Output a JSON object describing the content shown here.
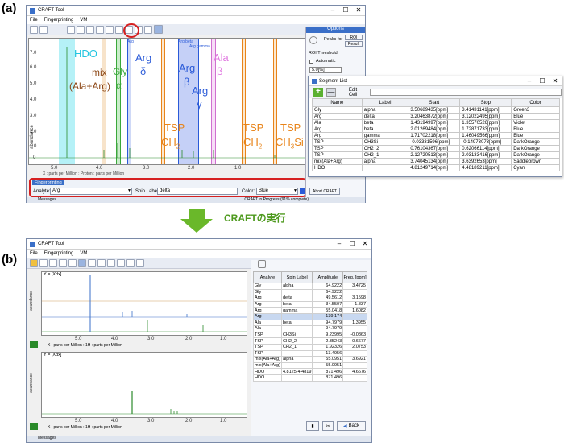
{
  "panel_a": {
    "label": "(a)",
    "window_title": "CRAFT Tool",
    "menu": [
      "File",
      "Fingerprinting",
      "VM"
    ],
    "y_axis_label": "abundance",
    "y_ticks": [
      "7.0",
      "6.0",
      "5.0",
      "4.0",
      "3.0",
      "2.0",
      "1.0",
      "0"
    ],
    "x_ticks": [
      "5.0",
      "4.0",
      "3.0",
      "2.0",
      "1.0"
    ],
    "x_axis_text": "X : parts per Million : Proton : parts per Million",
    "annotations": {
      "hdo": "HDO",
      "mix1": "mix",
      "mix2": "(Ala+Arg)",
      "gly1": "Gly",
      "gly2": "α",
      "arg_delta1": "Arg",
      "arg_delta2": "δ",
      "arg_beta1": "Arg",
      "arg_beta2": "β",
      "arg_gamma1": "Arg",
      "arg_gamma2": "γ",
      "ala1": "Ala",
      "ala2": "β",
      "tsp1_1": "TSP",
      "tsp1_2": "CH",
      "tsp1_sub": "2",
      "tsp2_1": "TSP",
      "tsp2_2": "CH",
      "tsp2_sub": "2",
      "tsp3_1": "TSP",
      "tsp3_2": "CH",
      "tsp3_sub": "3",
      "tsp3_end": "Si",
      "band_tag_arg_beta": "Arg beta",
      "band_tag_arg_gamma": "Arg gamma",
      "band_tag_arg": "Arg"
    },
    "options": {
      "title": "Options",
      "peaks_for": "Peaks for",
      "roi_button": "ROI",
      "result_button": "Result",
      "roi_threshold": "ROI Threshold",
      "automatic": "Automatic",
      "threshold_value": "5.0[%]",
      "abort_button": "Abort CRAFT"
    },
    "fingerprinting": {
      "tab": "Fingerprinting",
      "analyte_label": "Analyte:",
      "analyte_value": "Arg",
      "spin_label": "Spin Label:",
      "spin_value": "delta",
      "color_label": "Color:",
      "color_value": "Blue"
    },
    "status_left": "Messages",
    "status_right": "CRAFT in Progress (91% complete)",
    "segment_list": {
      "title": "Segment List",
      "edit_cell": "Edit Cell",
      "columns": [
        "Name",
        "Label",
        "Start",
        "Stop",
        "Color"
      ],
      "rows": [
        [
          "Gly",
          "alpha",
          "3.50689435[ppm]",
          "3.41431141[ppm]",
          "Green3"
        ],
        [
          "Arg",
          "delta",
          "3.20463872[ppm]",
          "3.12022495[ppm]",
          "Blue"
        ],
        [
          "Ala",
          "beta",
          "1.43194997[ppm]",
          "1.35570526[ppm]",
          "Violet"
        ],
        [
          "Arg",
          "beta",
          "2.01269484[ppm]",
          "1.72871733[ppm]",
          "Blue"
        ],
        [
          "Arg",
          "gamma",
          "1.71702218[ppm]",
          "1.46049566[ppm]",
          "Blue"
        ],
        [
          "TSP",
          "CH3Si",
          "-0.03331596[ppm]",
          "-0.14973073[ppm]",
          "DarkOrange"
        ],
        [
          "TSP",
          "CH2_2",
          "0.76104367[ppm]",
          "0.62066114[ppm]",
          "DarkOrange"
        ],
        [
          "TSP",
          "CH2_1",
          "2.12720513[ppm]",
          "2.03133416[ppm]",
          "DarkOrange"
        ],
        [
          "mix(Ala+Arg)",
          "alpha",
          "3.74045134[ppm]",
          "3.6392653[ppm]",
          "Saddlebrown"
        ],
        [
          "HDO",
          "",
          "4.81249714[ppm]",
          "4.48189211[ppm]",
          "Cyan"
        ]
      ]
    }
  },
  "arrow_caption": "CRAFTの実行",
  "panel_b": {
    "label": "(b)",
    "window_title": "CRAFT Tool",
    "menu": [
      "File",
      "Fingerprinting",
      "VM"
    ],
    "plot1_label": "Y = [Xdx]",
    "plot2_label": "Y = [Xdx]",
    "y_axis_label": "abundance",
    "x_ticks": [
      "5.0",
      "4.0",
      "3.0",
      "2.0",
      "1.0"
    ],
    "x_axis_text1": "X : parts per Million : 1H : parts per Million",
    "x_axis_text2": "X : parts per Million : 1H : parts per Million",
    "status_left": "Messages",
    "back_button": "Back",
    "result_columns": [
      "Analyte",
      "Spin Label",
      "Amplitude",
      "Freq.\n[ppm]"
    ],
    "result_rows": [
      [
        "Gly",
        "alpha",
        "64.9222",
        "3.4725"
      ],
      [
        "Gly",
        "",
        "64.9222",
        ""
      ],
      [
        "Arg",
        "delta",
        "49.5612",
        "3.1598"
      ],
      [
        "Arg",
        "beta",
        "34.5507",
        "1.837"
      ],
      [
        "Arg",
        "gamma",
        "55.0418",
        "1.6082"
      ],
      [
        "Arg",
        "",
        "139.174",
        ""
      ],
      [
        "Ala",
        "beta",
        "94.7979",
        "1.3955"
      ],
      [
        "Ala",
        "",
        "94.7979",
        ""
      ],
      [
        "TSP",
        "CH3Si",
        "9.23995",
        "-0.0863"
      ],
      [
        "TSP",
        "CH2_2",
        "2.35243",
        "0.6677"
      ],
      [
        "TSP",
        "CH2_1",
        "1.92326",
        "2.0753"
      ],
      [
        "TSP",
        "",
        "13.4956",
        ""
      ],
      [
        "mix(Ala+Arg)",
        "alpha",
        "55.0951",
        "3.6921"
      ],
      [
        "mix(Ala+Arg)",
        "",
        "55.0951",
        ""
      ],
      [
        "HDO",
        "4.8125-4.4819",
        "871.496",
        "4.6676"
      ],
      [
        "HDO",
        "",
        "871.496",
        ""
      ]
    ]
  },
  "colors": {
    "highlight_red": "#d62020",
    "arrow_green": "#6ab82a",
    "cyan": "#22c5e0",
    "orange": "#e8841a",
    "blue": "#2a5ad8",
    "green": "#3aa83a",
    "violet": "#d070d0",
    "brown": "#8b4513"
  }
}
